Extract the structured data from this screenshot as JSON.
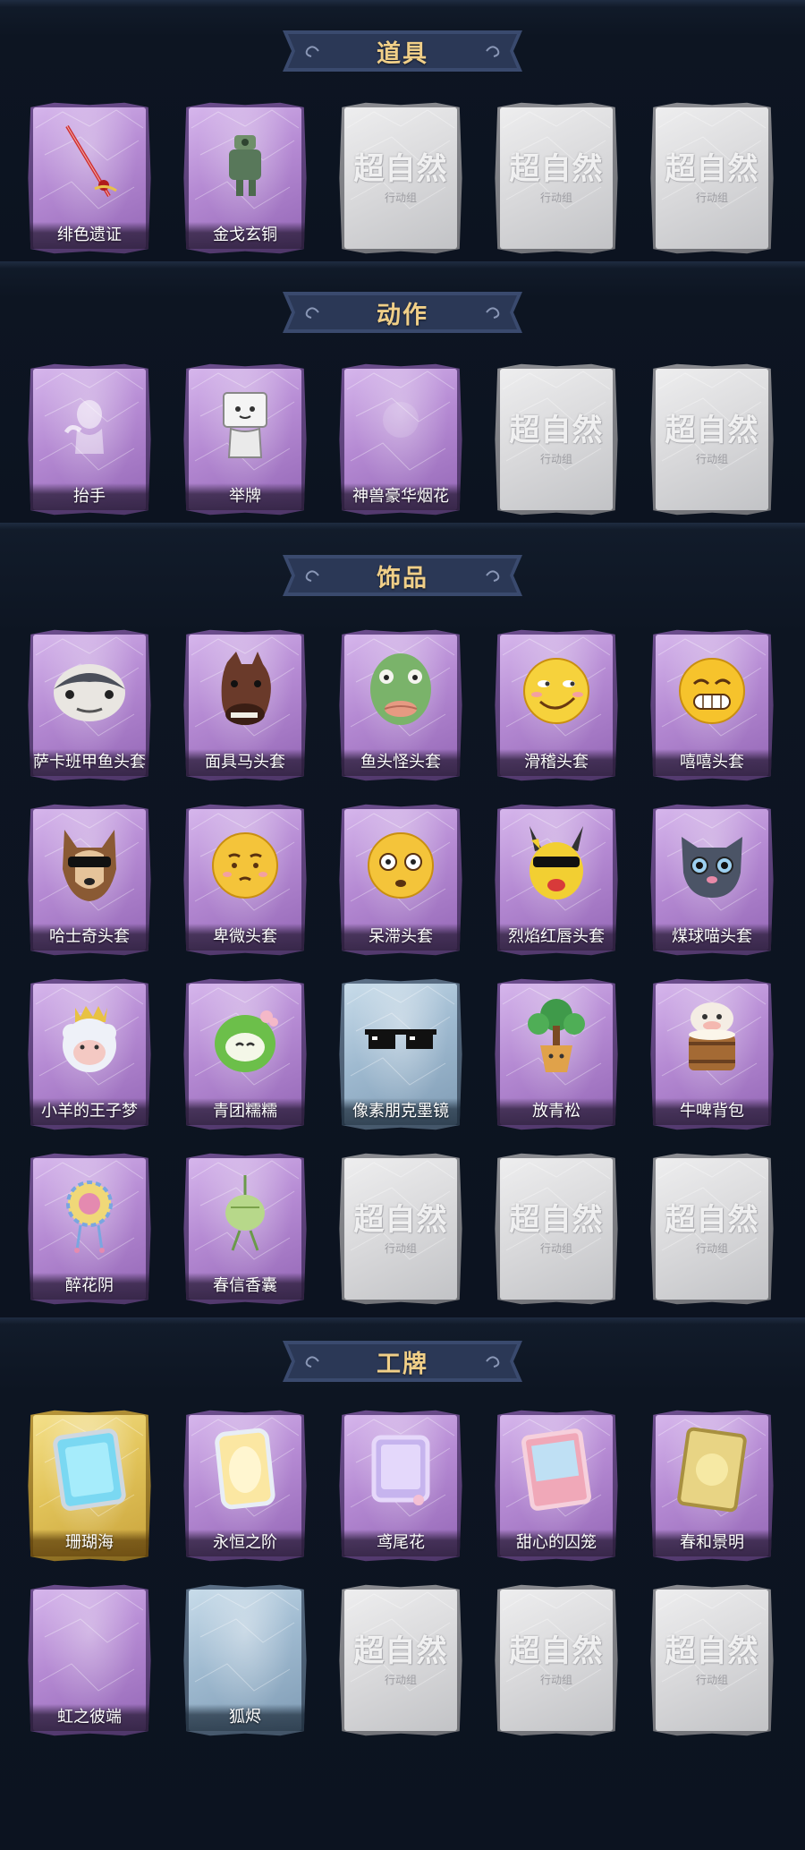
{
  "colors": {
    "background": "#0d1522",
    "banner": "#3a4a6e",
    "banner_text": "#f0cf88",
    "rarity_purple": "#b58ad3",
    "rarity_gold": "#e2c45a",
    "rarity_blue": "#9fbad0",
    "locked_gray": "#d9d9db"
  },
  "placeholder_watermark": {
    "main": "超自然",
    "sub": "行动组"
  },
  "sections": [
    {
      "title": "道具",
      "items": [
        {
          "name": "绯色遗证",
          "rarity": "purple",
          "icon": "sword-icon"
        },
        {
          "name": "金戈玄铜",
          "rarity": "purple",
          "icon": "bronze-figure-icon"
        },
        {
          "name": "",
          "rarity": "empty",
          "icon": "watermark-icon"
        },
        {
          "name": "",
          "rarity": "empty",
          "icon": "watermark-icon"
        },
        {
          "name": "",
          "rarity": "empty",
          "icon": "watermark-icon"
        }
      ]
    },
    {
      "title": "动作",
      "items": [
        {
          "name": "抬手",
          "rarity": "purple",
          "icon": "raise-hand-icon"
        },
        {
          "name": "举牌",
          "rarity": "purple",
          "icon": "hold-sign-icon"
        },
        {
          "name": "神兽豪华烟花",
          "rarity": "purple",
          "icon": "fireworks-icon"
        },
        {
          "name": "",
          "rarity": "empty",
          "icon": "watermark-icon"
        },
        {
          "name": "",
          "rarity": "empty",
          "icon": "watermark-icon"
        }
      ]
    },
    {
      "title": "饰品",
      "items": [
        {
          "name": "萨卡班甲鱼头套",
          "rarity": "purple",
          "icon": "fish-head-icon"
        },
        {
          "name": "面具马头套",
          "rarity": "purple",
          "icon": "horse-mask-icon"
        },
        {
          "name": "鱼头怪头套",
          "rarity": "purple",
          "icon": "fish-monster-icon"
        },
        {
          "name": "滑稽头套",
          "rarity": "purple",
          "icon": "smiley-icon"
        },
        {
          "name": "嘻嘻头套",
          "rarity": "purple",
          "icon": "grin-icon"
        },
        {
          "name": "哈士奇头套",
          "rarity": "purple",
          "icon": "husky-icon"
        },
        {
          "name": "卑微头套",
          "rarity": "purple",
          "icon": "humble-face-icon"
        },
        {
          "name": "呆滞头套",
          "rarity": "purple",
          "icon": "dazed-face-icon"
        },
        {
          "name": "烈焰红唇头套",
          "rarity": "purple",
          "icon": "pikachu-head-icon"
        },
        {
          "name": "煤球喵头套",
          "rarity": "purple",
          "icon": "cat-head-icon"
        },
        {
          "name": "小羊的王子梦",
          "rarity": "purple",
          "icon": "sheep-crown-icon"
        },
        {
          "name": "青团糯糯",
          "rarity": "purple",
          "icon": "green-bun-icon"
        },
        {
          "name": "像素朋克墨镜",
          "rarity": "blue",
          "icon": "pixel-sunglasses-icon"
        },
        {
          "name": "放青松",
          "rarity": "purple",
          "icon": "bonsai-icon"
        },
        {
          "name": "牛啤背包",
          "rarity": "purple",
          "icon": "cow-beer-icon"
        },
        {
          "name": "醉花阴",
          "rarity": "purple",
          "icon": "flower-ornament-icon"
        },
        {
          "name": "春信香囊",
          "rarity": "purple",
          "icon": "sachet-icon"
        },
        {
          "name": "",
          "rarity": "empty",
          "icon": "watermark-icon"
        },
        {
          "name": "",
          "rarity": "empty",
          "icon": "watermark-icon"
        },
        {
          "name": "",
          "rarity": "empty",
          "icon": "watermark-icon"
        }
      ]
    },
    {
      "title": "工牌",
      "items": [
        {
          "name": "珊瑚海",
          "rarity": "gold",
          "icon": "badge-blue-icon"
        },
        {
          "name": "永恒之阶",
          "rarity": "purple",
          "icon": "badge-gold-icon"
        },
        {
          "name": "鸢尾花",
          "rarity": "purple",
          "icon": "badge-lavender-icon"
        },
        {
          "name": "甜心的囚笼",
          "rarity": "purple",
          "icon": "badge-pink-icon"
        },
        {
          "name": "春和景明",
          "rarity": "purple",
          "icon": "badge-yellow-icon"
        },
        {
          "name": "虹之彼端",
          "rarity": "purple",
          "icon": "badge-empty-icon"
        },
        {
          "name": "狐烬",
          "rarity": "blue",
          "icon": "badge-empty-icon"
        },
        {
          "name": "",
          "rarity": "empty",
          "icon": "watermark-icon"
        },
        {
          "name": "",
          "rarity": "empty",
          "icon": "watermark-icon"
        },
        {
          "name": "",
          "rarity": "empty",
          "icon": "watermark-icon"
        }
      ]
    }
  ]
}
